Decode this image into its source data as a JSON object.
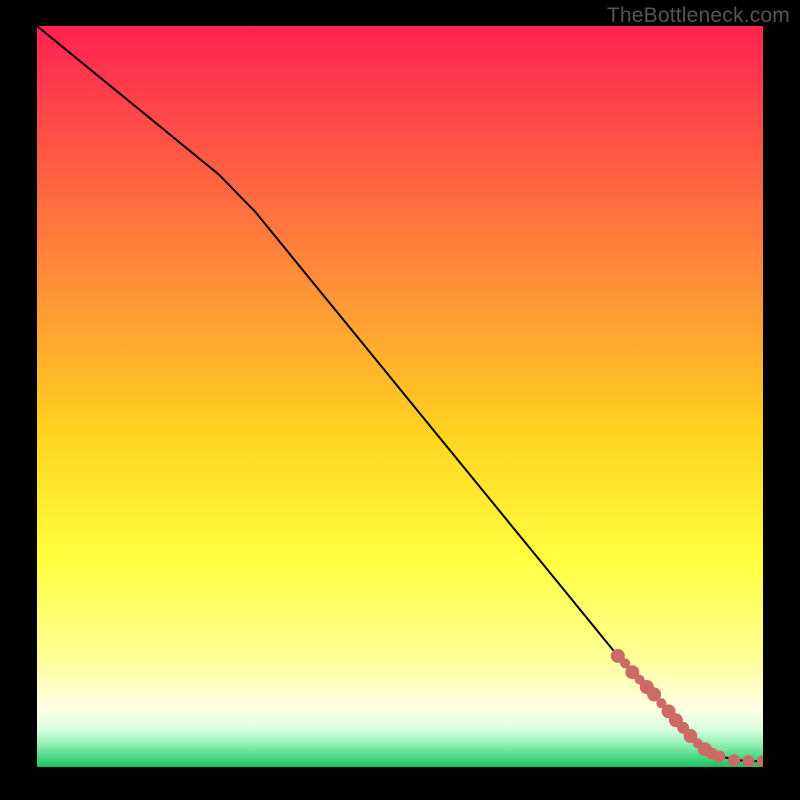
{
  "watermark": "TheBottleneck.com",
  "colors": {
    "bg_black": "#000000",
    "grad_top": "#ff2251",
    "grad_mid_upper": "#ff8a3a",
    "grad_mid": "#ffd720",
    "grad_lower": "#ffff55",
    "grad_pale": "#ffffe0",
    "grad_green": "#18c25e",
    "line": "#000000",
    "marker": "#cc6a66"
  },
  "chart_data": {
    "type": "line",
    "title": "",
    "xlabel": "",
    "ylabel": "",
    "xlim": [
      0,
      100
    ],
    "ylim": [
      0,
      100
    ],
    "grid": false,
    "legend": false,
    "series": [
      {
        "name": "curve",
        "x": [
          0,
          5,
          10,
          15,
          20,
          25,
          30,
          35,
          40,
          45,
          50,
          55,
          60,
          65,
          70,
          75,
          80,
          85,
          88,
          90,
          92,
          94,
          96,
          98,
          100
        ],
        "y": [
          100,
          96,
          92,
          88,
          84,
          80,
          75,
          69,
          63,
          57,
          51,
          45,
          39,
          33,
          27,
          21,
          15,
          10,
          6,
          4,
          2.5,
          1.5,
          1,
          0.8,
          0.8
        ]
      }
    ],
    "highlight_points": {
      "name": "salmon-markers",
      "x": [
        80,
        81,
        82,
        83,
        84,
        85,
        86,
        87,
        88,
        89,
        90,
        91,
        92,
        93,
        94,
        96,
        98,
        100
      ],
      "y": [
        15,
        14,
        12.8,
        11.8,
        10.8,
        9.8,
        8.6,
        7.5,
        6.3,
        5.3,
        4.2,
        3.2,
        2.4,
        1.8,
        1.4,
        0.9,
        0.8,
        0.8
      ],
      "r": [
        7,
        5,
        7,
        5,
        7,
        7,
        5,
        7,
        7,
        6,
        7,
        5,
        7,
        6,
        6,
        6,
        6,
        6
      ]
    }
  }
}
